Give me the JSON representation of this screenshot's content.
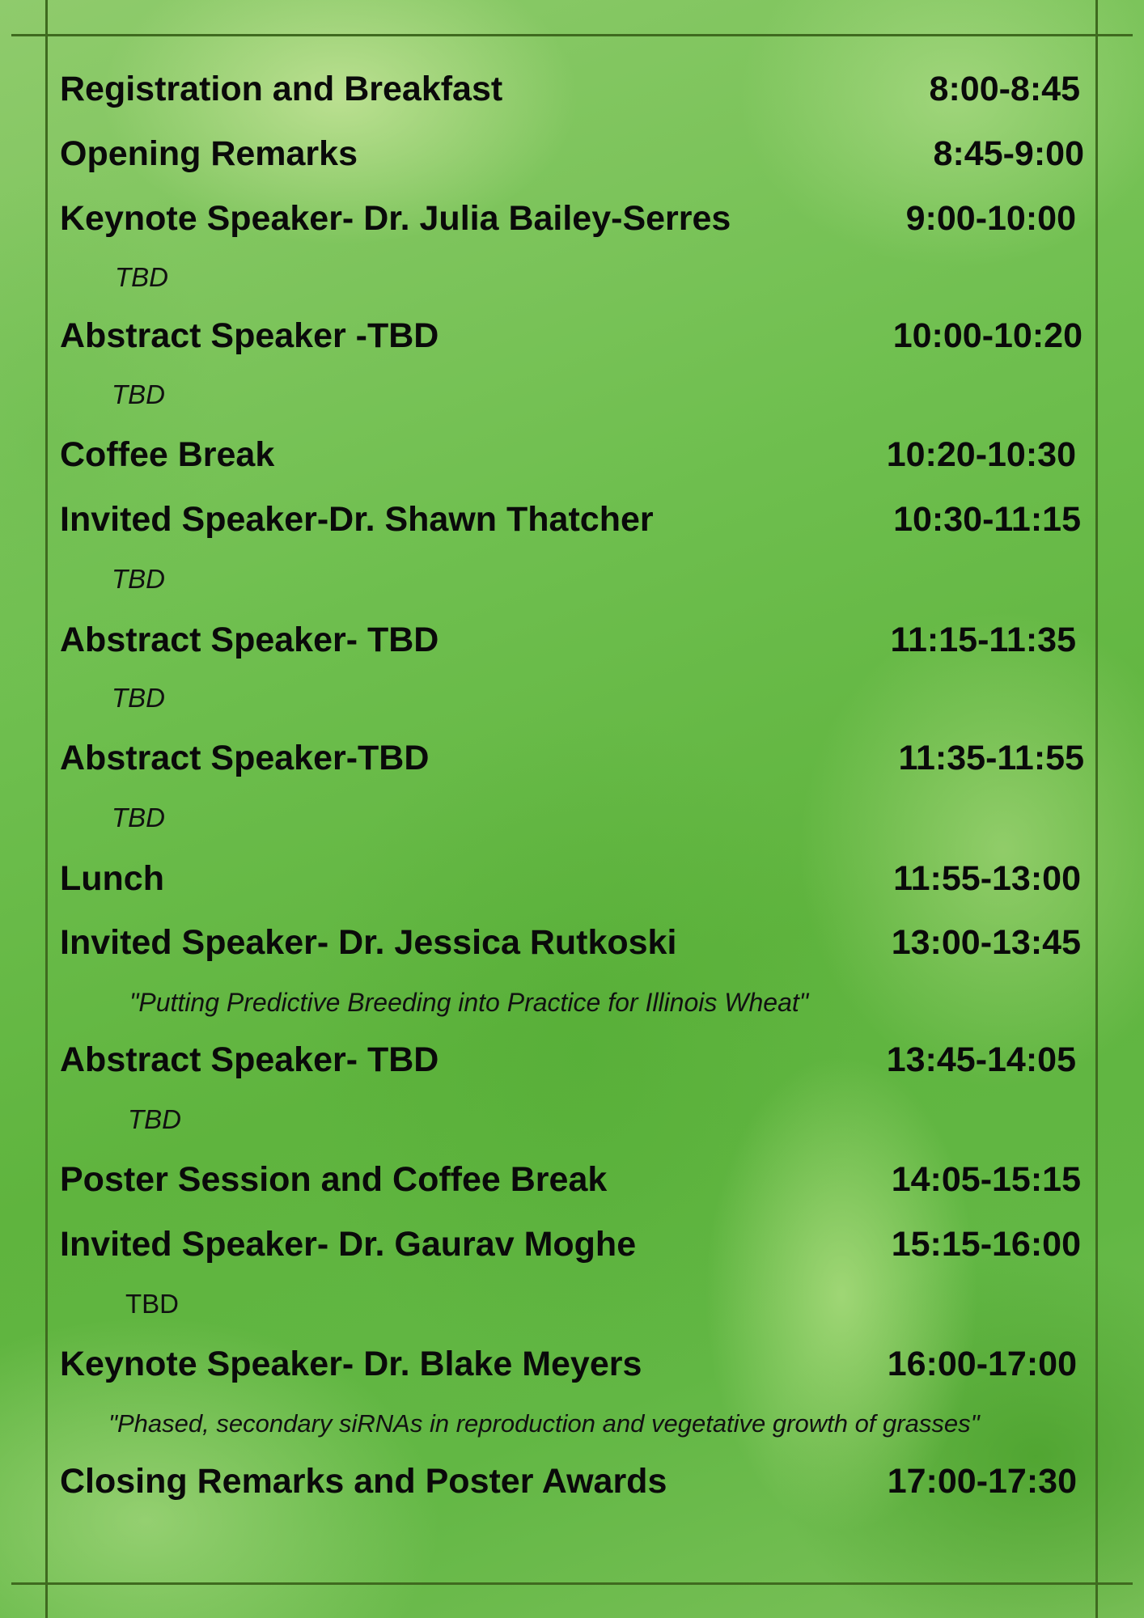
{
  "schedule": [
    {
      "title": "Registration and Breakfast",
      "time": "8:00-8:45"
    },
    {
      "title": "Opening Remarks",
      "time": "8:45-9:00"
    },
    {
      "title": "Keynote Speaker- Dr. Julia Bailey-Serres",
      "time": "9:00-10:00",
      "detail": "TBD"
    },
    {
      "title": "Abstract Speaker -TBD",
      "time": "10:00-10:20",
      "detail": "TBD"
    },
    {
      "title": "Coffee Break",
      "time": "10:20-10:30"
    },
    {
      "title": "Invited Speaker-Dr. Shawn Thatcher",
      "time": "10:30-11:15",
      "detail": "TBD"
    },
    {
      "title": "Abstract Speaker- TBD",
      "time": "11:15-11:35",
      "detail": "TBD"
    },
    {
      "title": "Abstract Speaker-TBD",
      "time": "11:35-11:55",
      "detail": "TBD"
    },
    {
      "title": "Lunch",
      "time": "11:55-13:00"
    },
    {
      "title": "Invited Speaker- Dr. Jessica Rutkoski",
      "time": "13:00-13:45",
      "detail": "\"Putting Predictive Breeding into Practice for Illinois Wheat\""
    },
    {
      "title": "Abstract Speaker- TBD",
      "time": "13:45-14:05",
      "detail": "TBD"
    },
    {
      "title": "Poster Session and Coffee Break",
      "time": "14:05-15:15"
    },
    {
      "title": "Invited Speaker- Dr. Gaurav Moghe",
      "time": "15:15-16:00",
      "detail": "TBD"
    },
    {
      "title": "Keynote Speaker- Dr. Blake Meyers",
      "time": "16:00-17:00",
      "detail": "\"Phased, secondary siRNAs in reproduction and vegetative growth of grasses\""
    },
    {
      "title": "Closing Remarks and Poster Awards",
      "time": "17:00-17:30"
    }
  ]
}
